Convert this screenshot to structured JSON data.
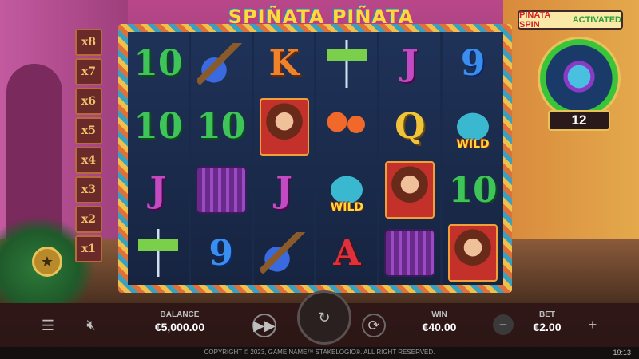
{
  "game": {
    "logo": "SPIÑATA PIÑATA",
    "activated_word1": "PIÑATA SPIN",
    "activated_word2": "ACTIVATED",
    "spins_remaining": "12"
  },
  "multipliers": [
    "x8",
    "x7",
    "x6",
    "x5",
    "x4",
    "x3",
    "x2",
    "x1"
  ],
  "reels": [
    [
      {
        "symbol": "10",
        "type": "text",
        "style": "c10"
      },
      {
        "symbol": "10",
        "type": "text",
        "style": "c10"
      },
      {
        "symbol": "J",
        "type": "text",
        "style": "cJ"
      },
      {
        "symbol": "martini-icon",
        "type": "pic",
        "style": "martini"
      }
    ],
    [
      {
        "symbol": "guitar-icon",
        "type": "pic",
        "style": "guitar"
      },
      {
        "symbol": "10",
        "type": "text",
        "style": "c10"
      },
      {
        "symbol": "accordion-icon",
        "type": "pic",
        "style": "accordion"
      },
      {
        "symbol": "9",
        "type": "text",
        "style": "c9"
      }
    ],
    [
      {
        "symbol": "K",
        "type": "text",
        "style": "cK"
      },
      {
        "symbol": "senorita-icon",
        "type": "pic",
        "style": "woman"
      },
      {
        "symbol": "J",
        "type": "text",
        "style": "cJ"
      },
      {
        "symbol": "guitar-icon",
        "type": "pic",
        "style": "guitar"
      }
    ],
    [
      {
        "symbol": "martini-icon",
        "type": "pic",
        "style": "martini"
      },
      {
        "symbol": "maracas-icon",
        "type": "pic",
        "style": "maracas"
      },
      {
        "symbol": "pinata-wild-icon",
        "type": "wild",
        "style": "pinata",
        "wild": "WILD"
      },
      {
        "symbol": "A",
        "type": "text",
        "style": "cA"
      }
    ],
    [
      {
        "symbol": "J",
        "type": "text",
        "style": "cJ"
      },
      {
        "symbol": "Q",
        "type": "text",
        "style": "cQ"
      },
      {
        "symbol": "senorita-icon",
        "type": "pic",
        "style": "woman"
      },
      {
        "symbol": "accordion-icon",
        "type": "pic",
        "style": "accordion"
      }
    ],
    [
      {
        "symbol": "9",
        "type": "text",
        "style": "c9"
      },
      {
        "symbol": "pinata-wild-icon",
        "type": "wild",
        "style": "pinata",
        "wild": "WILD"
      },
      {
        "symbol": "10",
        "type": "text",
        "style": "c10"
      },
      {
        "symbol": "senorita-icon",
        "type": "pic",
        "style": "woman"
      }
    ]
  ],
  "controls": {
    "balance_label": "BALANCE",
    "balance_value": "€5,000.00",
    "win_label": "WIN",
    "win_value": "€40.00",
    "bet_label": "BET",
    "bet_value": "€2.00",
    "menu_icon": "menu-icon",
    "mute_icon": "sound-muted-icon",
    "turbo_icon": "fast-forward-icon",
    "spin_icon": "spin-icon",
    "autoplay_icon": "autoplay-icon",
    "minus_icon": "minus-icon",
    "plus_icon": "plus-icon"
  },
  "footer": {
    "copyright": "COPYRIGHT © 2023, GAME NAME™ STAKELOGIC®. ALL RIGHT RESERVED.",
    "clock": "19:13"
  }
}
